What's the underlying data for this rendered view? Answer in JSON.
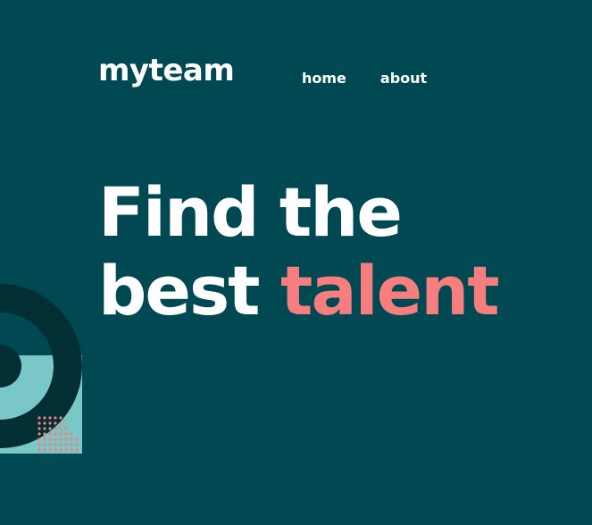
{
  "header": {
    "logo": "myteam",
    "nav": [
      {
        "label": "home"
      },
      {
        "label": "about"
      }
    ]
  },
  "hero": {
    "line1": "Find the",
    "line2_plain": "best",
    "line2_accent": "talent"
  },
  "colors": {
    "background": "#004953",
    "accent": "#f67e7e",
    "light_teal": "#79c8c7",
    "dark_teal": "#012f34",
    "text": "#ffffff"
  }
}
